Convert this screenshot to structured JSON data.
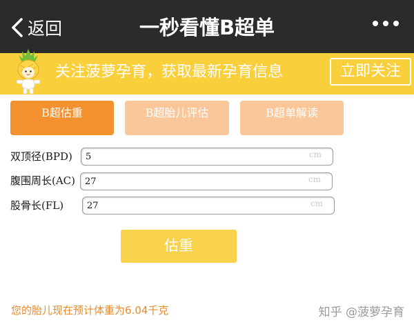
{
  "header": {
    "back_label": "返回",
    "title": "一秒看懂B超单"
  },
  "banner": {
    "text": "关注菠萝孕育，获取最新孕育信息",
    "button_label": "立即关注"
  },
  "tabs": [
    {
      "label": "B超估重",
      "active": true
    },
    {
      "label": "B超胎儿评估",
      "active": false
    },
    {
      "label": "B超单解读",
      "active": false
    }
  ],
  "form": {
    "fields": [
      {
        "label": "双顶径(BPD)",
        "value": "5",
        "unit": "cm"
      },
      {
        "label": "腹围周长(AC)",
        "value": "27",
        "unit": "cm"
      },
      {
        "label": "股骨长(FL)",
        "value": "27",
        "unit": "cm"
      }
    ],
    "calc_button": "估重"
  },
  "result_text": "您的胎儿现在预计体重为6.04千克",
  "watermark": "知乎 @菠萝孕育",
  "colors": {
    "topbar": "#2b2b2b",
    "banner": "#f9cf3b",
    "tab_active": "#f3912e",
    "tab_inactive": "#f9c79a",
    "calc_button": "#f9d24b",
    "result_text": "#e98a2a"
  }
}
